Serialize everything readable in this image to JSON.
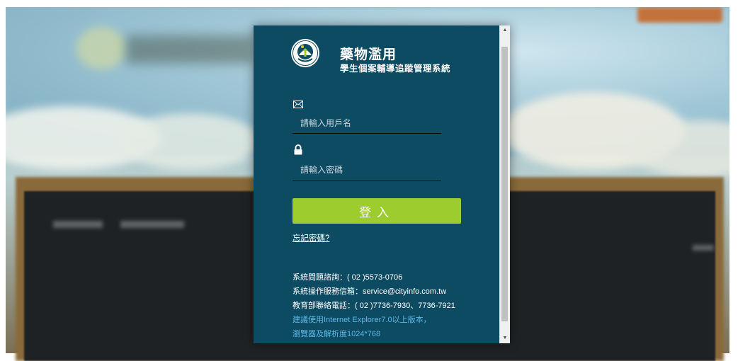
{
  "brand": {
    "title": "藥物濫用",
    "subtitle": "學生個案輔導追蹤管理系統",
    "logo_ring_text": "MINISTRY OF EDUCATION",
    "logo_bottom_text": "教育部"
  },
  "form": {
    "username_placeholder": "請輸入用戶名",
    "password_placeholder": "請輸入密碼",
    "login_label": "登入",
    "forgot_label": "忘記密碼?"
  },
  "contact": {
    "line1": "系統問題諮詢：( 02 )5573-0706",
    "line2": "系統操作服務信箱：service@cityinfo.com.tw",
    "line3": "教育部聯絡電話：( 02 )7736-7930、7736-7921",
    "note1": "建議使用Internet Explorer7.0以上版本，",
    "note2": "瀏覽器及解析度1024*768"
  },
  "icons": {
    "mail": "mail-icon",
    "lock": "lock-icon",
    "scroll_up": "chevron-up-icon",
    "scroll_down": "chevron-down-icon"
  },
  "colors": {
    "modal_bg": "#0d4b63",
    "login_button": "#9ccc2e",
    "note_text": "#5bb8e6"
  }
}
